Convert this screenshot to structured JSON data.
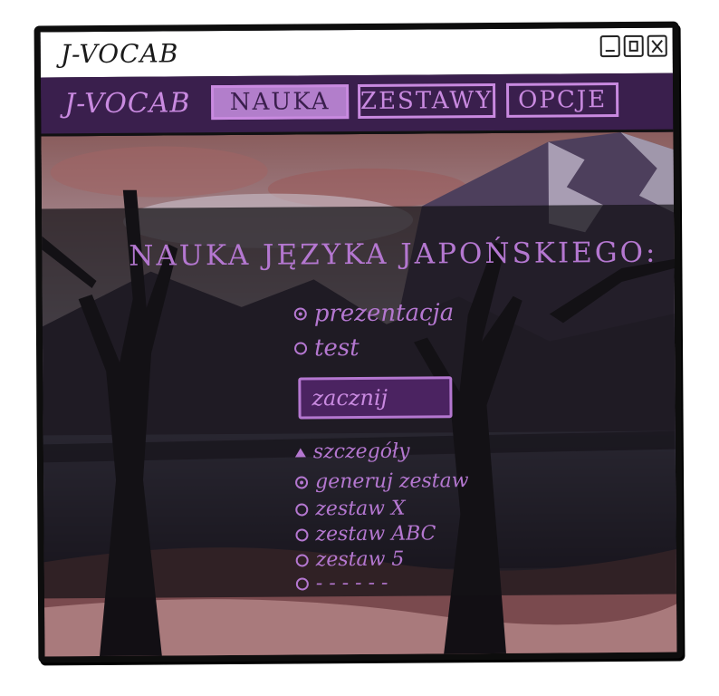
{
  "window": {
    "title": "J-VOCAB"
  },
  "menu": {
    "brand": "J-VOCAB",
    "items": [
      {
        "label": "NAUKA",
        "active": true
      },
      {
        "label": "ZESTAWY",
        "active": false
      },
      {
        "label": "OPCJE",
        "active": false
      }
    ]
  },
  "main": {
    "heading": "NAUKA JĘZYKA JAPOŃSKIEGO:",
    "modes": [
      {
        "label": "prezentacja",
        "selected": true
      },
      {
        "label": "test",
        "selected": false
      }
    ],
    "start_button": "zacznij",
    "details_label": "szczegóły",
    "sets": [
      {
        "label": "generuj zestaw",
        "selected": true
      },
      {
        "label": "zestaw X",
        "selected": false
      },
      {
        "label": "zestaw ABC",
        "selected": false
      },
      {
        "label": "zestaw 5",
        "selected": false
      },
      {
        "label": "- - - - - -",
        "selected": false
      }
    ]
  },
  "colors": {
    "accent": "#b477d0",
    "menubar": "#3a1f4d",
    "button": "#4b2361"
  }
}
